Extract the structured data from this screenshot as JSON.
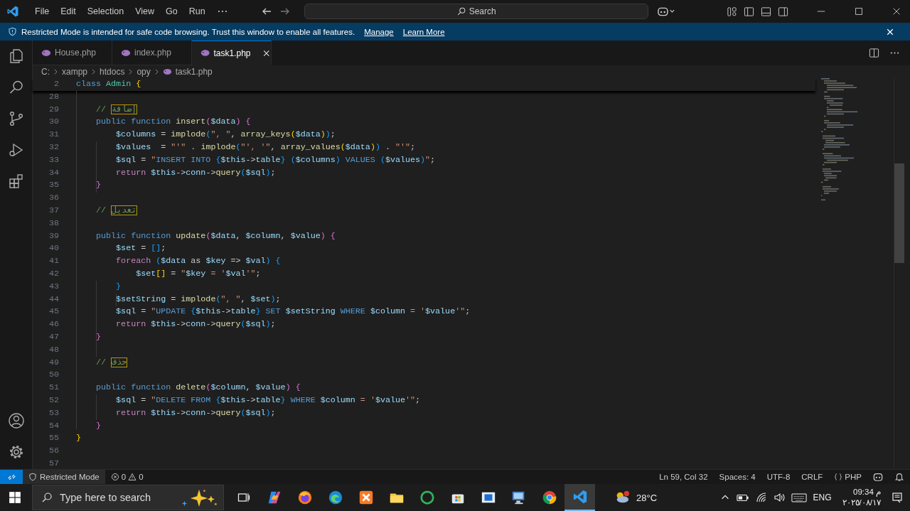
{
  "menu": [
    "File",
    "Edit",
    "Selection",
    "View",
    "Go",
    "Run"
  ],
  "search": {
    "label": "Search"
  },
  "banner": {
    "text": "Restricted Mode is intended for safe code browsing. Trust this window to enable all features.",
    "links": [
      "Manage",
      "Learn More"
    ]
  },
  "tabs": [
    {
      "label": "House.php",
      "selected": false
    },
    {
      "label": "index.php",
      "selected": false
    },
    {
      "label": "task1.php",
      "selected": true
    }
  ],
  "breadcrumbs": [
    "C:",
    "xampp",
    "htdocs",
    "opy",
    "task1.php"
  ],
  "sticky_line": {
    "number": "2",
    "tokens": [
      {
        "kind": "keyword",
        "text": "class "
      },
      {
        "kind": "type",
        "text": "Admin"
      },
      {
        "kind": "bracket1",
        "text": " {"
      }
    ]
  },
  "lines": [
    {
      "number": "28"
    },
    {
      "number": "29",
      "tokens": [
        {
          "kind": "comment",
          "text": "    // "
        },
        {
          "kind": "unicode-highlight",
          "text": "إضافة"
        }
      ]
    },
    {
      "number": "30",
      "tokens": [
        {
          "kind": "keyword",
          "text": "    public function "
        },
        {
          "kind": "function",
          "text": "insert"
        },
        {
          "kind": "bracket2",
          "text": "("
        },
        {
          "kind": "variable",
          "text": "$data"
        },
        {
          "kind": "bracket2",
          "text": ") {"
        }
      ]
    },
    {
      "number": "31",
      "tokens": [
        {
          "kind": "variable",
          "text": "        $columns"
        },
        {
          "kind": "plain",
          "text": " = "
        },
        {
          "kind": "function",
          "text": "implode"
        },
        {
          "kind": "bracket3",
          "text": "("
        },
        {
          "kind": "string",
          "text": "\", \""
        },
        {
          "kind": "plain",
          "text": ", "
        },
        {
          "kind": "function",
          "text": "array_keys"
        },
        {
          "kind": "bracket1",
          "text": "("
        },
        {
          "kind": "variable",
          "text": "$data"
        },
        {
          "kind": "bracket1",
          "text": ")"
        },
        {
          "kind": "bracket3",
          "text": ")"
        },
        {
          "kind": "plain",
          "text": ";"
        }
      ]
    },
    {
      "number": "32",
      "tokens": [
        {
          "kind": "variable",
          "text": "        $values"
        },
        {
          "kind": "plain",
          "text": "  = "
        },
        {
          "kind": "string",
          "text": "\"'\""
        },
        {
          "kind": "plain",
          "text": " . "
        },
        {
          "kind": "function",
          "text": "implode"
        },
        {
          "kind": "bracket3",
          "text": "("
        },
        {
          "kind": "string",
          "text": "\"', '\""
        },
        {
          "kind": "plain",
          "text": ", "
        },
        {
          "kind": "function",
          "text": "array_values"
        },
        {
          "kind": "bracket1",
          "text": "("
        },
        {
          "kind": "variable",
          "text": "$data"
        },
        {
          "kind": "bracket1",
          "text": ")"
        },
        {
          "kind": "bracket3",
          "text": ")"
        },
        {
          "kind": "plain",
          "text": " . "
        },
        {
          "kind": "string",
          "text": "\"'\""
        },
        {
          "kind": "plain",
          "text": ";"
        }
      ]
    },
    {
      "number": "33",
      "tokens": [
        {
          "kind": "variable",
          "text": "        $sql"
        },
        {
          "kind": "plain",
          "text": " = "
        },
        {
          "kind": "string",
          "text": "\""
        },
        {
          "kind": "keyword",
          "text": "INSERT INTO "
        },
        {
          "kind": "bracket3",
          "text": "{"
        },
        {
          "kind": "variable",
          "text": "$this"
        },
        {
          "kind": "plain",
          "text": "->"
        },
        {
          "kind": "variable",
          "text": "table"
        },
        {
          "kind": "bracket3",
          "text": "}"
        },
        {
          "kind": "bracket3",
          "text": " ("
        },
        {
          "kind": "variable",
          "text": "$columns"
        },
        {
          "kind": "bracket3",
          "text": ")"
        },
        {
          "kind": "keyword",
          "text": " VALUES "
        },
        {
          "kind": "bracket3",
          "text": "("
        },
        {
          "kind": "variable",
          "text": "$values"
        },
        {
          "kind": "bracket3",
          "text": ")"
        },
        {
          "kind": "string",
          "text": "\""
        },
        {
          "kind": "plain",
          "text": ";"
        }
      ]
    },
    {
      "number": "34",
      "tokens": [
        {
          "kind": "control",
          "text": "        return "
        },
        {
          "kind": "variable",
          "text": "$this"
        },
        {
          "kind": "plain",
          "text": "->"
        },
        {
          "kind": "variable",
          "text": "conn"
        },
        {
          "kind": "plain",
          "text": "->"
        },
        {
          "kind": "function",
          "text": "query"
        },
        {
          "kind": "bracket3",
          "text": "("
        },
        {
          "kind": "variable",
          "text": "$sql"
        },
        {
          "kind": "bracket3",
          "text": ")"
        },
        {
          "kind": "plain",
          "text": ";"
        }
      ]
    },
    {
      "number": "35",
      "tokens": [
        {
          "kind": "bracket2",
          "text": "    }"
        }
      ]
    },
    {
      "number": "36"
    },
    {
      "number": "37",
      "tokens": [
        {
          "kind": "comment",
          "text": "    // "
        },
        {
          "kind": "unicode-highlight",
          "text": "تعديل"
        }
      ]
    },
    {
      "number": "38"
    },
    {
      "number": "39",
      "tokens": [
        {
          "kind": "keyword",
          "text": "    public function "
        },
        {
          "kind": "function",
          "text": "update"
        },
        {
          "kind": "bracket2",
          "text": "("
        },
        {
          "kind": "variable",
          "text": "$data"
        },
        {
          "kind": "plain",
          "text": ", "
        },
        {
          "kind": "variable",
          "text": "$column"
        },
        {
          "kind": "plain",
          "text": ", "
        },
        {
          "kind": "variable",
          "text": "$value"
        },
        {
          "kind": "bracket2",
          "text": ") {"
        }
      ]
    },
    {
      "number": "40",
      "tokens": [
        {
          "kind": "variable",
          "text": "        $set"
        },
        {
          "kind": "plain",
          "text": " = "
        },
        {
          "kind": "bracket3",
          "text": "[]"
        },
        {
          "kind": "plain",
          "text": ";"
        }
      ]
    },
    {
      "number": "41",
      "tokens": [
        {
          "kind": "control",
          "text": "        foreach "
        },
        {
          "kind": "bracket3",
          "text": "("
        },
        {
          "kind": "variable",
          "text": "$data"
        },
        {
          "kind": "plain",
          "text": " as "
        },
        {
          "kind": "variable",
          "text": "$key"
        },
        {
          "kind": "plain",
          "text": " => "
        },
        {
          "kind": "variable",
          "text": "$val"
        },
        {
          "kind": "bracket3",
          "text": ") {"
        }
      ]
    },
    {
      "number": "42",
      "tokens": [
        {
          "kind": "variable",
          "text": "            $set"
        },
        {
          "kind": "bracket1",
          "text": "[]"
        },
        {
          "kind": "plain",
          "text": " = "
        },
        {
          "kind": "string",
          "text": "\""
        },
        {
          "kind": "variable",
          "text": "$key"
        },
        {
          "kind": "string",
          "text": " = '"
        },
        {
          "kind": "variable",
          "text": "$val"
        },
        {
          "kind": "string",
          "text": "'\""
        },
        {
          "kind": "plain",
          "text": ";"
        }
      ]
    },
    {
      "number": "43",
      "tokens": [
        {
          "kind": "bracket3",
          "text": "        }"
        }
      ]
    },
    {
      "number": "44",
      "tokens": [
        {
          "kind": "variable",
          "text": "        $setString"
        },
        {
          "kind": "plain",
          "text": " = "
        },
        {
          "kind": "function",
          "text": "implode"
        },
        {
          "kind": "bracket3",
          "text": "("
        },
        {
          "kind": "string",
          "text": "\", \""
        },
        {
          "kind": "plain",
          "text": ", "
        },
        {
          "kind": "variable",
          "text": "$set"
        },
        {
          "kind": "bracket3",
          "text": ")"
        },
        {
          "kind": "plain",
          "text": ";"
        }
      ]
    },
    {
      "number": "45",
      "tokens": [
        {
          "kind": "variable",
          "text": "        $sql"
        },
        {
          "kind": "plain",
          "text": " = "
        },
        {
          "kind": "string",
          "text": "\""
        },
        {
          "kind": "keyword",
          "text": "UPDATE "
        },
        {
          "kind": "bracket3",
          "text": "{"
        },
        {
          "kind": "variable",
          "text": "$this"
        },
        {
          "kind": "plain",
          "text": "->"
        },
        {
          "kind": "variable",
          "text": "table"
        },
        {
          "kind": "bracket3",
          "text": "}"
        },
        {
          "kind": "keyword",
          "text": " SET "
        },
        {
          "kind": "variable",
          "text": "$setString"
        },
        {
          "kind": "keyword",
          "text": " WHERE "
        },
        {
          "kind": "variable",
          "text": "$column"
        },
        {
          "kind": "string",
          "text": " = '"
        },
        {
          "kind": "variable",
          "text": "$value"
        },
        {
          "kind": "string",
          "text": "'\""
        },
        {
          "kind": "plain",
          "text": ";"
        }
      ]
    },
    {
      "number": "46",
      "tokens": [
        {
          "kind": "control",
          "text": "        return "
        },
        {
          "kind": "variable",
          "text": "$this"
        },
        {
          "kind": "plain",
          "text": "->"
        },
        {
          "kind": "variable",
          "text": "conn"
        },
        {
          "kind": "plain",
          "text": "->"
        },
        {
          "kind": "function",
          "text": "query"
        },
        {
          "kind": "bracket3",
          "text": "("
        },
        {
          "kind": "variable",
          "text": "$sql"
        },
        {
          "kind": "bracket3",
          "text": ")"
        },
        {
          "kind": "plain",
          "text": ";"
        }
      ]
    },
    {
      "number": "47",
      "tokens": [
        {
          "kind": "bracket2",
          "text": "    }"
        }
      ]
    },
    {
      "number": "48"
    },
    {
      "number": "49",
      "tokens": [
        {
          "kind": "comment",
          "text": "    // "
        },
        {
          "kind": "unicode-highlight",
          "text": "حذف"
        }
      ]
    },
    {
      "number": "50"
    },
    {
      "number": "51",
      "tokens": [
        {
          "kind": "keyword",
          "text": "    public function "
        },
        {
          "kind": "function",
          "text": "delete"
        },
        {
          "kind": "bracket2",
          "text": "("
        },
        {
          "kind": "variable",
          "text": "$column"
        },
        {
          "kind": "plain",
          "text": ", "
        },
        {
          "kind": "variable",
          "text": "$value"
        },
        {
          "kind": "bracket2",
          "text": ") {"
        }
      ]
    },
    {
      "number": "52",
      "tokens": [
        {
          "kind": "variable",
          "text": "        $sql"
        },
        {
          "kind": "plain",
          "text": " = "
        },
        {
          "kind": "string",
          "text": "\""
        },
        {
          "kind": "keyword",
          "text": "DELETE FROM "
        },
        {
          "kind": "bracket3",
          "text": "{"
        },
        {
          "kind": "variable",
          "text": "$this"
        },
        {
          "kind": "plain",
          "text": "->"
        },
        {
          "kind": "variable",
          "text": "table"
        },
        {
          "kind": "bracket3",
          "text": "}"
        },
        {
          "kind": "keyword",
          "text": " WHERE "
        },
        {
          "kind": "variable",
          "text": "$column"
        },
        {
          "kind": "string",
          "text": " = '"
        },
        {
          "kind": "variable",
          "text": "$value"
        },
        {
          "kind": "string",
          "text": "'\""
        },
        {
          "kind": "plain",
          "text": ";"
        }
      ]
    },
    {
      "number": "53",
      "tokens": [
        {
          "kind": "control",
          "text": "        return "
        },
        {
          "kind": "variable",
          "text": "$this"
        },
        {
          "kind": "plain",
          "text": "->"
        },
        {
          "kind": "variable",
          "text": "conn"
        },
        {
          "kind": "plain",
          "text": "->"
        },
        {
          "kind": "function",
          "text": "query"
        },
        {
          "kind": "bracket3",
          "text": "("
        },
        {
          "kind": "variable",
          "text": "$sql"
        },
        {
          "kind": "bracket3",
          "text": ")"
        },
        {
          "kind": "plain",
          "text": ";"
        }
      ]
    },
    {
      "number": "54",
      "tokens": [
        {
          "kind": "bracket2",
          "text": "    }"
        }
      ]
    },
    {
      "number": "55",
      "tokens": [
        {
          "kind": "bracket1",
          "text": "}"
        }
      ]
    },
    {
      "number": "56"
    },
    {
      "number": "57"
    }
  ],
  "status_bar": {
    "mode": "Restricted Mode",
    "errors": "0",
    "warnings": "0",
    "position": "Ln 59, Col 32",
    "indentation": "Spaces: 4",
    "encoding": "UTF-8",
    "line_ending": "CRLF",
    "language": "PHP"
  },
  "taskbar": {
    "search_placeholder": "Type here to search",
    "apps": [
      {
        "kind": "taskview",
        "selected": false
      },
      {
        "kind": "copilot",
        "selected": false
      },
      {
        "kind": "firefox",
        "selected": false
      },
      {
        "kind": "edge",
        "selected": false
      },
      {
        "kind": "xampp",
        "selected": false
      },
      {
        "kind": "folder",
        "selected": false
      },
      {
        "kind": "circle-app",
        "selected": false
      },
      {
        "kind": "store",
        "selected": false
      },
      {
        "kind": "window-app",
        "selected": false
      },
      {
        "kind": "remote",
        "selected": false
      },
      {
        "kind": "chrome",
        "selected": false
      },
      {
        "kind": "vscode",
        "selected": true
      }
    ],
    "weather": "28°C",
    "language": "ENG",
    "time": "09:34 م",
    "date": "٢٠٢٥/٠٨/١٧"
  }
}
